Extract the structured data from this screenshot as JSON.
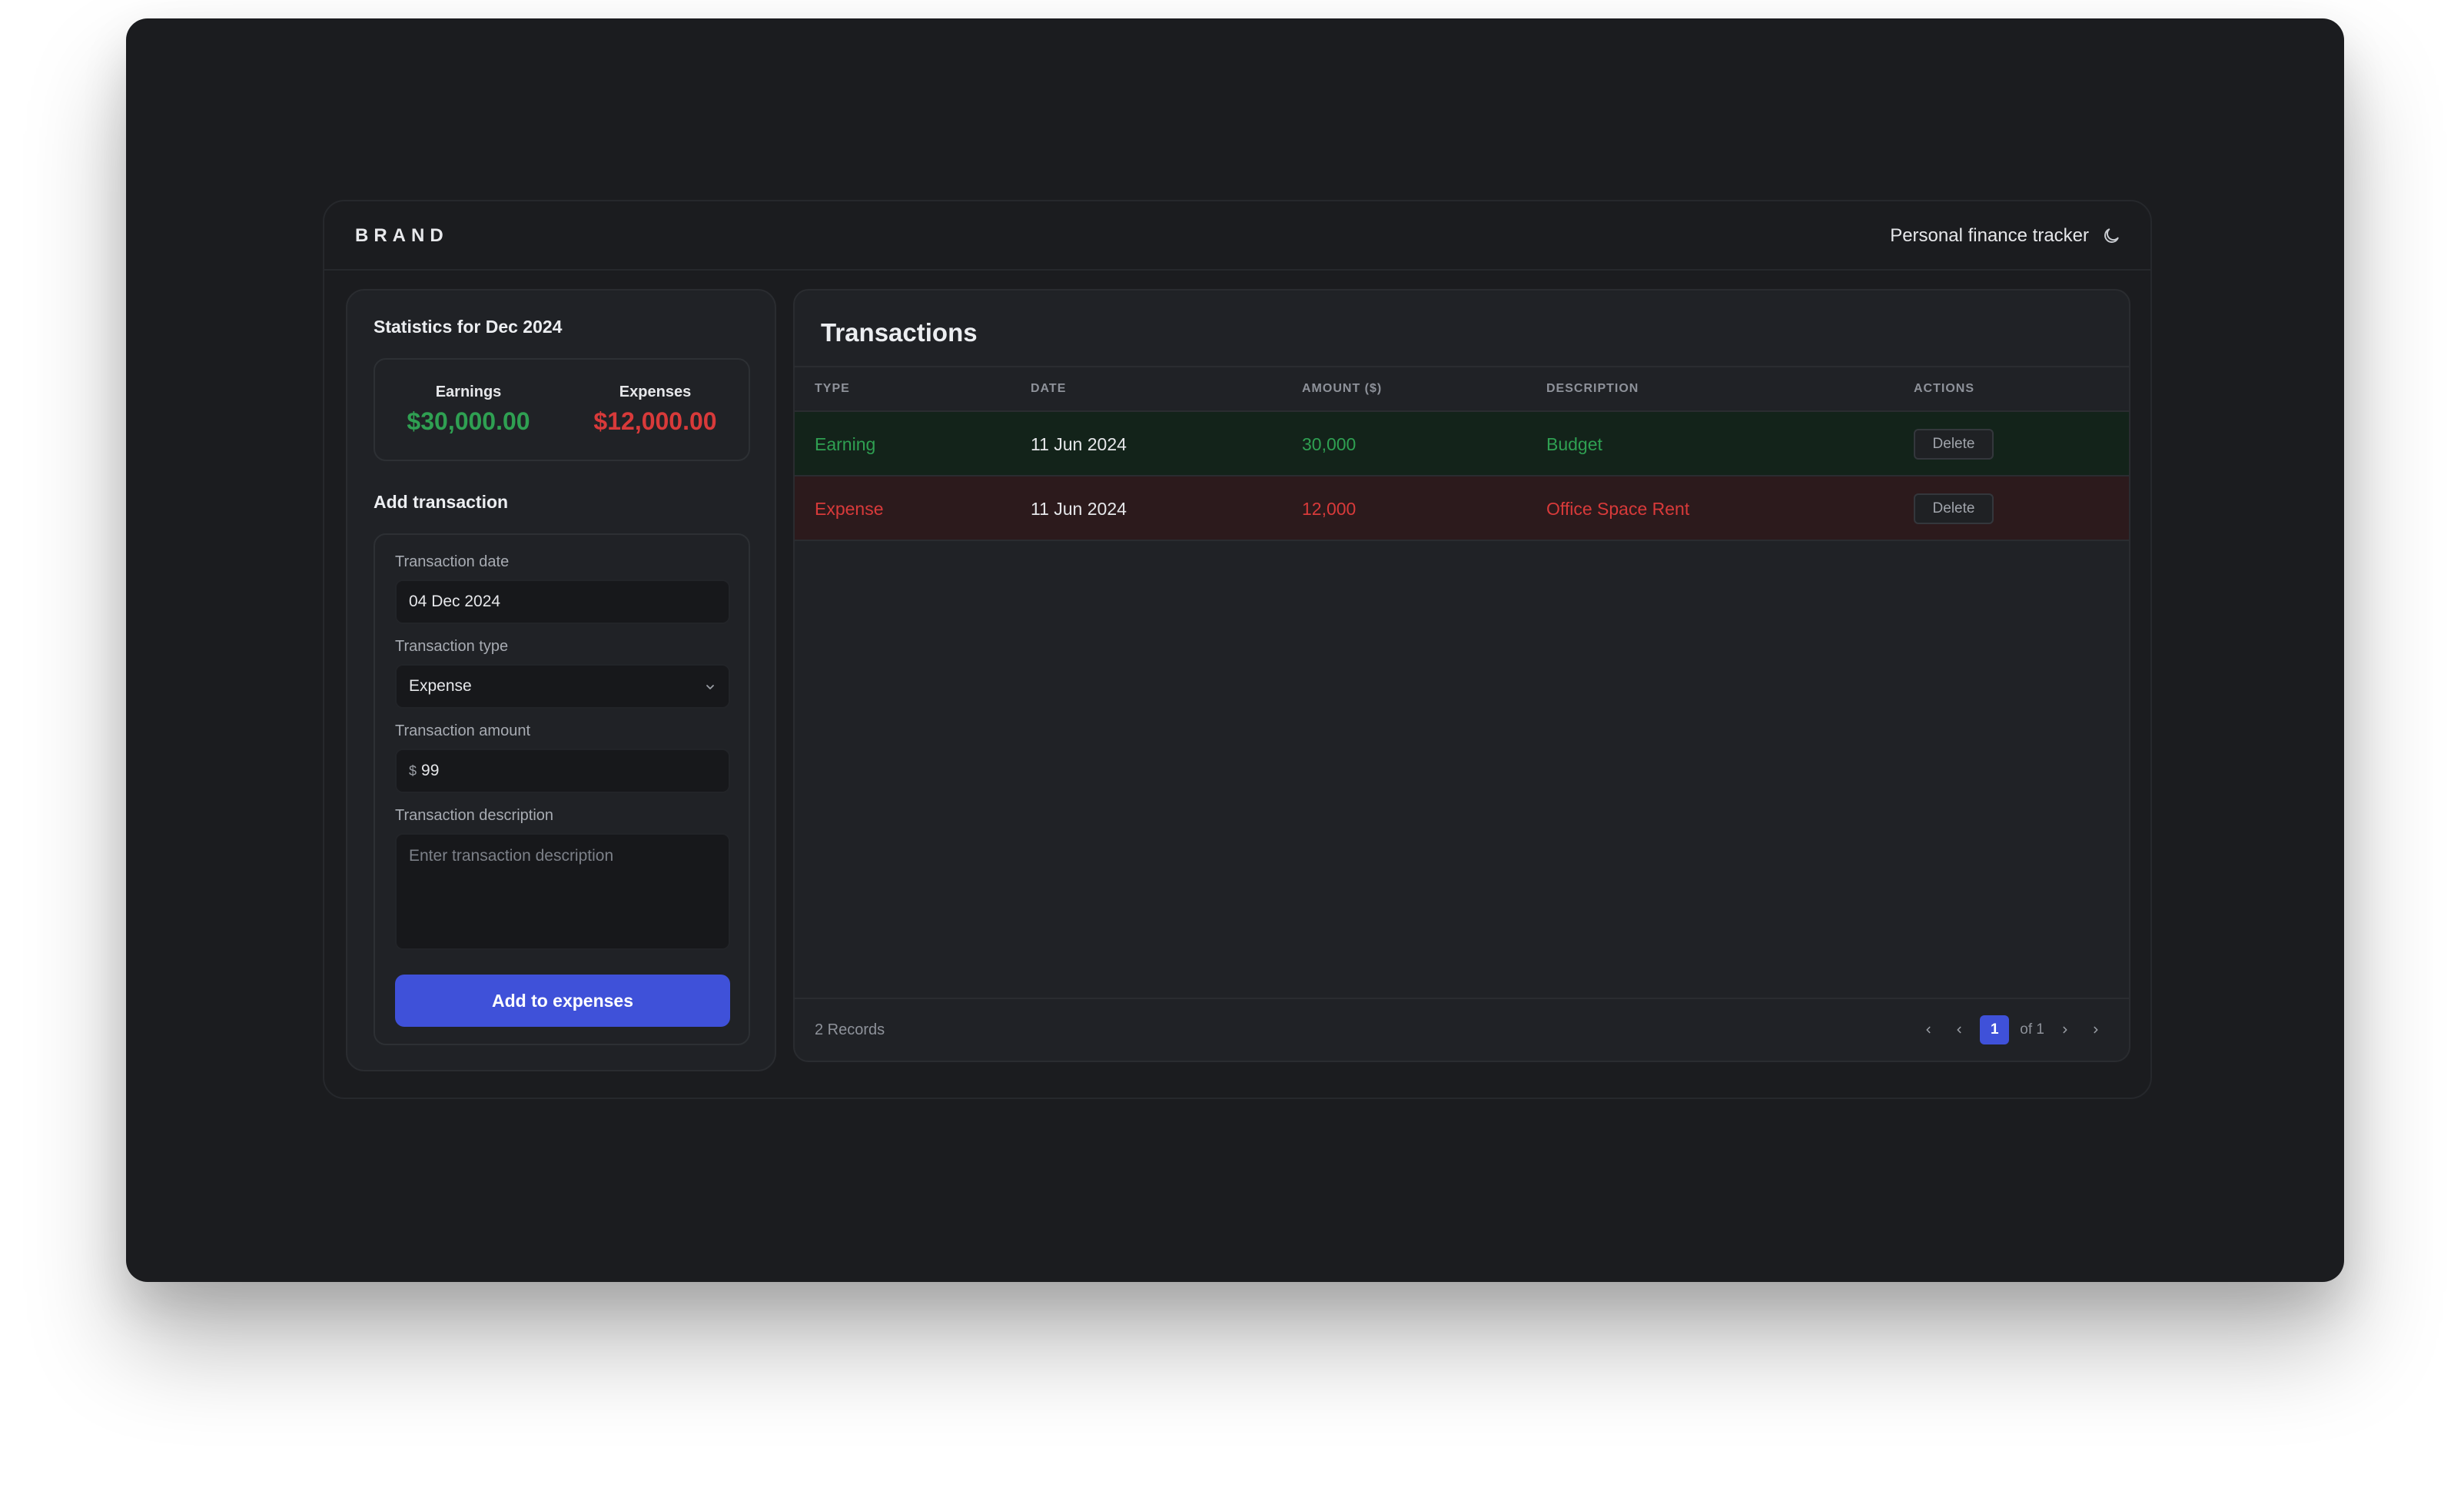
{
  "header": {
    "brand": "BRAND",
    "app_title": "Personal finance tracker",
    "theme_icon": "moon-icon"
  },
  "stats": {
    "title": "Statistics for Dec 2024",
    "earnings_label": "Earnings",
    "earnings_value": "$30,000.00",
    "expenses_label": "Expenses",
    "expenses_value": "$12,000.00"
  },
  "form": {
    "title": "Add transaction",
    "date_label": "Transaction date",
    "date_value": "04 Dec 2024",
    "type_label": "Transaction type",
    "type_value": "Expense",
    "amount_label": "Transaction amount",
    "amount_prefix": "$",
    "amount_value": "99",
    "description_label": "Transaction description",
    "description_placeholder": "Enter transaction description",
    "submit_label": "Add to expenses"
  },
  "transactions": {
    "title": "Transactions",
    "columns": [
      "TYPE",
      "DATE",
      "AMOUNT ($)",
      "DESCRIPTION",
      "ACTIONS"
    ],
    "rows": [
      {
        "type": "Earning",
        "date": "11 Jun 2024",
        "amount": "30,000",
        "description": "Budget",
        "action": "Delete"
      },
      {
        "type": "Expense",
        "date": "11 Jun 2024",
        "amount": "12,000",
        "description": "Office Space Rent",
        "action": "Delete"
      }
    ],
    "records": "2 Records",
    "pagination": {
      "current": "1",
      "of_label": "of 1"
    }
  },
  "colors": {
    "accent": "#3f51d9",
    "earning": "#2fa052",
    "expense": "#d83a3a",
    "background": "#1b1c1f"
  }
}
